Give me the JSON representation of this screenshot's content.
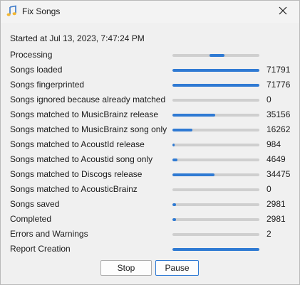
{
  "window": {
    "title": "Fix Songs",
    "close_icon": "close-icon",
    "app_icon": "music-note-icon"
  },
  "started": "Started at Jul 13, 2023, 7:47:24 PM",
  "accent_color": "#2f7ad3",
  "rows": [
    {
      "label": "Processing",
      "value": "",
      "progress": null,
      "indeterminate": true
    },
    {
      "label": "Songs loaded",
      "value": "71791",
      "progress": 1.0
    },
    {
      "label": "Songs fingerprinted",
      "value": "71776",
      "progress": 1.0
    },
    {
      "label": "Songs ignored because already matched",
      "value": "0",
      "progress": 0.0
    },
    {
      "label": "Songs matched to MusicBrainz release",
      "value": "35156",
      "progress": 0.49
    },
    {
      "label": "Songs matched to MusicBrainz song only",
      "value": "16262",
      "progress": 0.23
    },
    {
      "label": "Songs matched to AcoustId release",
      "value": "984",
      "progress": 0.02
    },
    {
      "label": "Songs matched to Acoustid song only",
      "value": "4649",
      "progress": 0.06
    },
    {
      "label": "Songs matched to Discogs release",
      "value": "34475",
      "progress": 0.48
    },
    {
      "label": "Songs matched to AcousticBrainz",
      "value": "0",
      "progress": 0.0
    },
    {
      "label": "Songs saved",
      "value": "2981",
      "progress": 0.04
    },
    {
      "label": "Completed",
      "value": "2981",
      "progress": 0.04
    },
    {
      "label": "Errors and Warnings",
      "value": "2",
      "progress": 0.0
    },
    {
      "label": "Report Creation",
      "value": "",
      "progress": 1.0
    }
  ],
  "buttons": {
    "stop": "Stop",
    "pause": "Pause"
  }
}
